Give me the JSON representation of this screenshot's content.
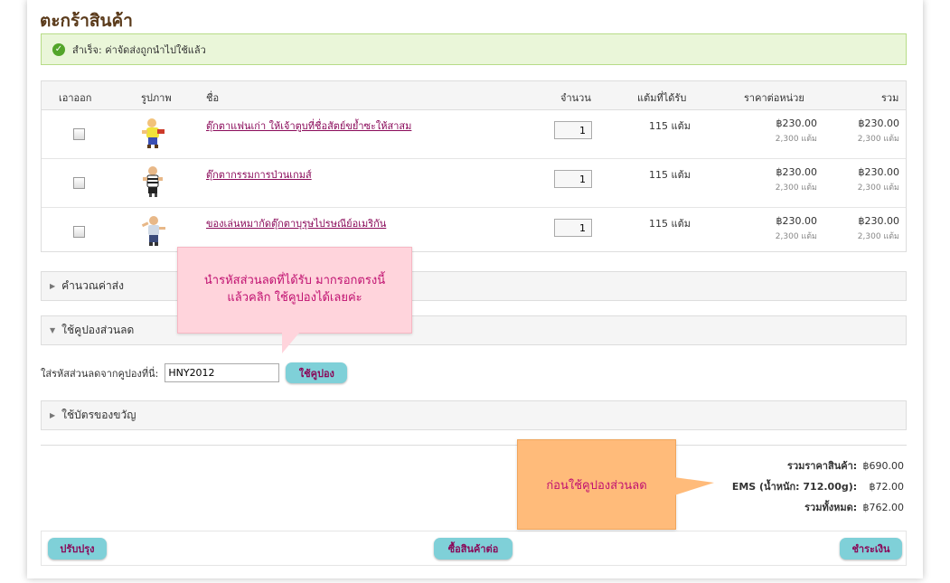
{
  "page": {
    "title": "ตะกร้าสินค้า"
  },
  "alert": {
    "message": "สำเร็จ: ค่าจัดส่งถูกนำไปใช้แล้ว",
    "icon": "check-circle-icon"
  },
  "table": {
    "headers": {
      "remove": "เอาออก",
      "image": "รูปภาพ",
      "name": "ชื่อ",
      "qty": "จำนวน",
      "points": "แต้มที่ได้รับ",
      "unit_price": "ราคาต่อหน่วย",
      "total": "รวม"
    },
    "rows": [
      {
        "name": "ตุ๊กตาแฟนเก่า ให้เจ้าตูบที่ชื่อสัตย์ขย้ำซะให้สาสม",
        "qty": "1",
        "points": "115 แต้ม",
        "unit_price": "฿230.00",
        "unit_points": "2,300 แต้ม",
        "total": "฿230.00",
        "total_points": "2,300 แต้ม"
      },
      {
        "name": "ตุ๊กตากรรมการป่วนเกมส์",
        "qty": "1",
        "points": "115 แต้ม",
        "unit_price": "฿230.00",
        "unit_points": "2,300 แต้ม",
        "total": "฿230.00",
        "total_points": "2,300 แต้ม"
      },
      {
        "name": "ของเล่นหมากัดตุ๊กตาบุรุษไปรษณีย์อเมริกัน",
        "qty": "1",
        "points": "115 แต้ม",
        "unit_price": "฿230.00",
        "unit_points": "2,300 แต้ม",
        "total": "฿230.00",
        "total_points": "2,300 แต้ม"
      }
    ]
  },
  "sections": {
    "shipping": "คำนวณค่าส่ง",
    "coupon": "ใช้คูปองส่วนลด",
    "voucher": "ใช้บัตรของขวัญ"
  },
  "coupon": {
    "label": "ใส่รหัสส่วนลดจากคูปองที่นี่:",
    "value": "HNY2012",
    "button": "ใช้คูปอง"
  },
  "totals": {
    "subtotal_label": "รวมราคาสินค้า:",
    "subtotal": "฿690.00",
    "shipping_label": "EMS (น้ำหนัก: 712.00g):",
    "shipping": "฿72.00",
    "grand_label": "รวมทั้งหมด:",
    "grand": "฿762.00"
  },
  "footer": {
    "update": "ปรับปรุง",
    "continue": "ซื้อสินค้าต่อ",
    "checkout": "ชำระเงิน"
  },
  "callouts": {
    "pink_line1": "นำรหัสส่วนลดที่ได้รับ มากรอกตรงนี้",
    "pink_line2": "แล้วคลิก ใช้คูปองได้เลยค่ะ",
    "orange": "ก่อนใช้คูปองส่วนลด"
  },
  "colors": {
    "accent_button": "#7fd0d8",
    "link": "#8a0a5a",
    "title": "#5a3a1a",
    "success": "#53a52a"
  }
}
